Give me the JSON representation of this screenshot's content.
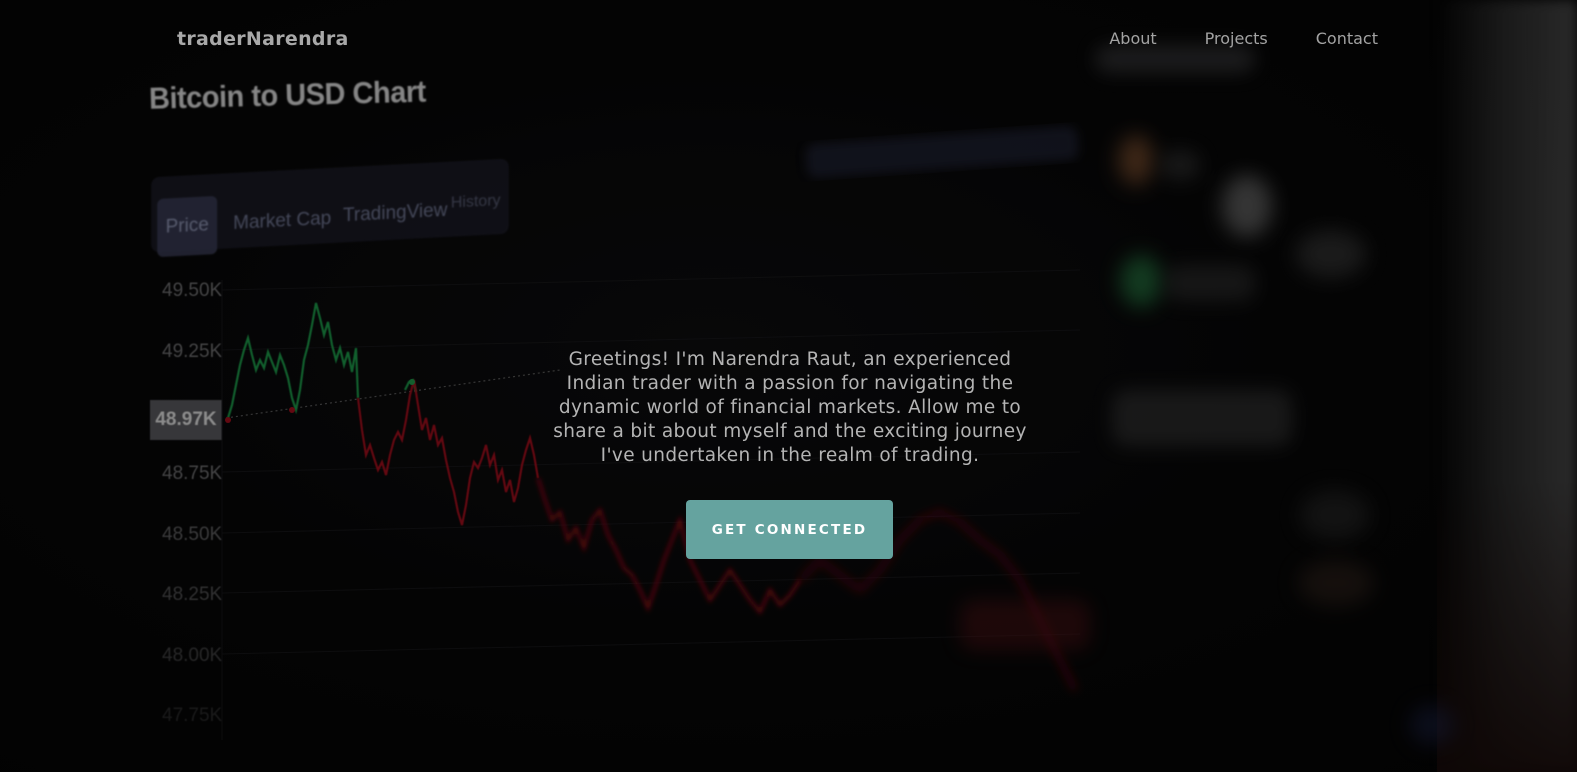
{
  "nav": {
    "brand": "traderNarendra",
    "links": [
      {
        "label": "About"
      },
      {
        "label": "Projects"
      },
      {
        "label": "Contact"
      }
    ]
  },
  "hero": {
    "intro": "Greetings! I'm Narendra Raut, an experienced Indian trader with a passion for navigating the dynamic world of financial markets. Allow me to share a bit about myself and the exciting journey I've undertaken in the realm of trading.",
    "cta_label": "GET CONNECTED"
  },
  "background_image": {
    "title": "Bitcoin to USD Chart",
    "tabs": [
      "Price",
      "Market Cap",
      "TradingView",
      "History"
    ],
    "active_tab": "Price",
    "price_axis": [
      "49.50K",
      "49.25K",
      "48.97K",
      "48.75K",
      "48.50K",
      "48.25K",
      "48.00K",
      "47.75K"
    ],
    "current_price": "48.97K"
  },
  "colors": {
    "accent": "#65a39f",
    "page_bg": "#050505",
    "text": "#b4b4b4",
    "nav_text": "#a3a3a3",
    "chart_up": "#1f9a4a",
    "chart_down": "#a0101c"
  }
}
